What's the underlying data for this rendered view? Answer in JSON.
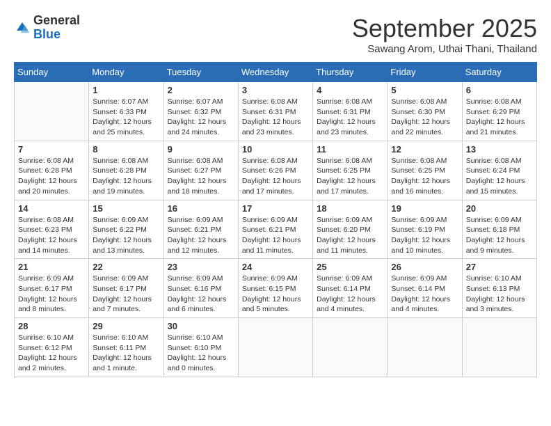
{
  "header": {
    "logo": {
      "general": "General",
      "blue": "Blue"
    },
    "title": "September 2025",
    "subtitle": "Sawang Arom, Uthai Thani, Thailand"
  },
  "weekdays": [
    "Sunday",
    "Monday",
    "Tuesday",
    "Wednesday",
    "Thursday",
    "Friday",
    "Saturday"
  ],
  "weeks": [
    [
      {
        "day": "",
        "info": ""
      },
      {
        "day": "1",
        "info": "Sunrise: 6:07 AM\nSunset: 6:33 PM\nDaylight: 12 hours\nand 25 minutes."
      },
      {
        "day": "2",
        "info": "Sunrise: 6:07 AM\nSunset: 6:32 PM\nDaylight: 12 hours\nand 24 minutes."
      },
      {
        "day": "3",
        "info": "Sunrise: 6:08 AM\nSunset: 6:31 PM\nDaylight: 12 hours\nand 23 minutes."
      },
      {
        "day": "4",
        "info": "Sunrise: 6:08 AM\nSunset: 6:31 PM\nDaylight: 12 hours\nand 23 minutes."
      },
      {
        "day": "5",
        "info": "Sunrise: 6:08 AM\nSunset: 6:30 PM\nDaylight: 12 hours\nand 22 minutes."
      },
      {
        "day": "6",
        "info": "Sunrise: 6:08 AM\nSunset: 6:29 PM\nDaylight: 12 hours\nand 21 minutes."
      }
    ],
    [
      {
        "day": "7",
        "info": "Sunrise: 6:08 AM\nSunset: 6:28 PM\nDaylight: 12 hours\nand 20 minutes."
      },
      {
        "day": "8",
        "info": "Sunrise: 6:08 AM\nSunset: 6:28 PM\nDaylight: 12 hours\nand 19 minutes."
      },
      {
        "day": "9",
        "info": "Sunrise: 6:08 AM\nSunset: 6:27 PM\nDaylight: 12 hours\nand 18 minutes."
      },
      {
        "day": "10",
        "info": "Sunrise: 6:08 AM\nSunset: 6:26 PM\nDaylight: 12 hours\nand 17 minutes."
      },
      {
        "day": "11",
        "info": "Sunrise: 6:08 AM\nSunset: 6:25 PM\nDaylight: 12 hours\nand 17 minutes."
      },
      {
        "day": "12",
        "info": "Sunrise: 6:08 AM\nSunset: 6:25 PM\nDaylight: 12 hours\nand 16 minutes."
      },
      {
        "day": "13",
        "info": "Sunrise: 6:08 AM\nSunset: 6:24 PM\nDaylight: 12 hours\nand 15 minutes."
      }
    ],
    [
      {
        "day": "14",
        "info": "Sunrise: 6:08 AM\nSunset: 6:23 PM\nDaylight: 12 hours\nand 14 minutes."
      },
      {
        "day": "15",
        "info": "Sunrise: 6:09 AM\nSunset: 6:22 PM\nDaylight: 12 hours\nand 13 minutes."
      },
      {
        "day": "16",
        "info": "Sunrise: 6:09 AM\nSunset: 6:21 PM\nDaylight: 12 hours\nand 12 minutes."
      },
      {
        "day": "17",
        "info": "Sunrise: 6:09 AM\nSunset: 6:21 PM\nDaylight: 12 hours\nand 11 minutes."
      },
      {
        "day": "18",
        "info": "Sunrise: 6:09 AM\nSunset: 6:20 PM\nDaylight: 12 hours\nand 11 minutes."
      },
      {
        "day": "19",
        "info": "Sunrise: 6:09 AM\nSunset: 6:19 PM\nDaylight: 12 hours\nand 10 minutes."
      },
      {
        "day": "20",
        "info": "Sunrise: 6:09 AM\nSunset: 6:18 PM\nDaylight: 12 hours\nand 9 minutes."
      }
    ],
    [
      {
        "day": "21",
        "info": "Sunrise: 6:09 AM\nSunset: 6:17 PM\nDaylight: 12 hours\nand 8 minutes."
      },
      {
        "day": "22",
        "info": "Sunrise: 6:09 AM\nSunset: 6:17 PM\nDaylight: 12 hours\nand 7 minutes."
      },
      {
        "day": "23",
        "info": "Sunrise: 6:09 AM\nSunset: 6:16 PM\nDaylight: 12 hours\nand 6 minutes."
      },
      {
        "day": "24",
        "info": "Sunrise: 6:09 AM\nSunset: 6:15 PM\nDaylight: 12 hours\nand 5 minutes."
      },
      {
        "day": "25",
        "info": "Sunrise: 6:09 AM\nSunset: 6:14 PM\nDaylight: 12 hours\nand 4 minutes."
      },
      {
        "day": "26",
        "info": "Sunrise: 6:09 AM\nSunset: 6:14 PM\nDaylight: 12 hours\nand 4 minutes."
      },
      {
        "day": "27",
        "info": "Sunrise: 6:10 AM\nSunset: 6:13 PM\nDaylight: 12 hours\nand 3 minutes."
      }
    ],
    [
      {
        "day": "28",
        "info": "Sunrise: 6:10 AM\nSunset: 6:12 PM\nDaylight: 12 hours\nand 2 minutes."
      },
      {
        "day": "29",
        "info": "Sunrise: 6:10 AM\nSunset: 6:11 PM\nDaylight: 12 hours\nand 1 minute."
      },
      {
        "day": "30",
        "info": "Sunrise: 6:10 AM\nSunset: 6:10 PM\nDaylight: 12 hours\nand 0 minutes."
      },
      {
        "day": "",
        "info": ""
      },
      {
        "day": "",
        "info": ""
      },
      {
        "day": "",
        "info": ""
      },
      {
        "day": "",
        "info": ""
      }
    ]
  ]
}
